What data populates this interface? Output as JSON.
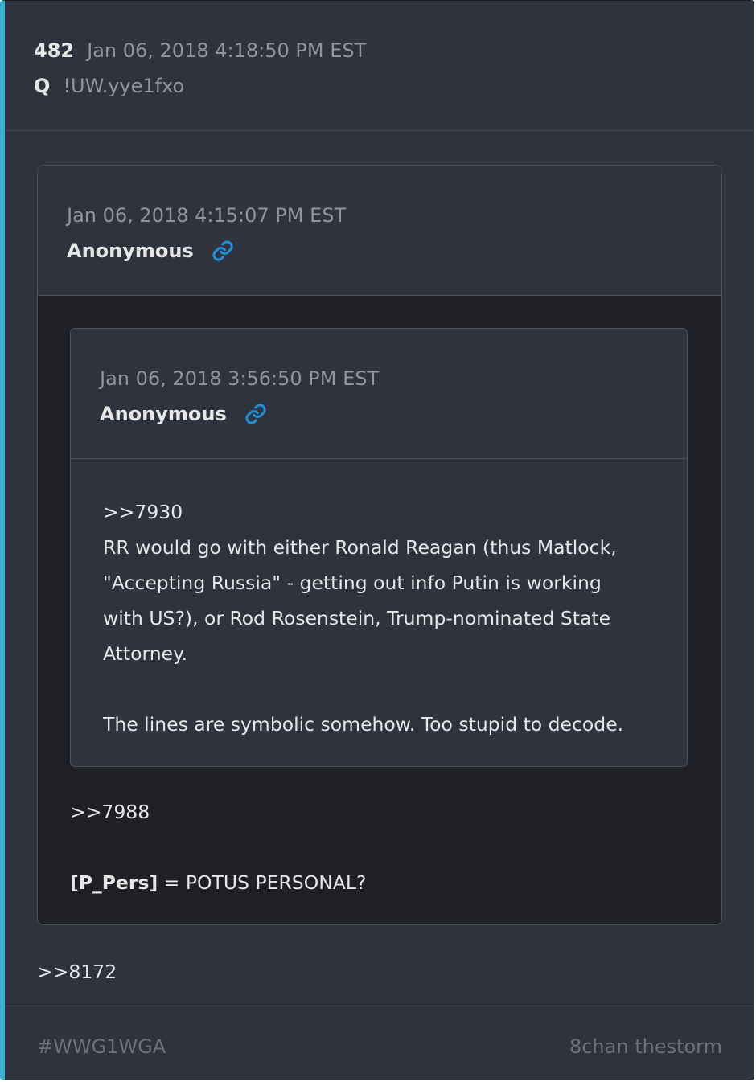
{
  "post": {
    "number": "482",
    "timestamp": "Jan 06, 2018 4:18:50 PM EST",
    "author": "Q",
    "tripcode": "!UW.yye1fxo",
    "reference": ">>8172"
  },
  "quoted_post": {
    "timestamp": "Jan 06, 2018 4:15:07 PM EST",
    "author": "Anonymous",
    "link_icon": "link-icon",
    "text_ref": ">>7988",
    "text_bold": "[P_Pers]",
    "text_rest": " = POTUS PERSONAL?"
  },
  "nested_post": {
    "timestamp": "Jan 06, 2018 3:56:50 PM EST",
    "author": "Anonymous",
    "link_icon": "link-icon",
    "text_ref": ">>7930",
    "text_para1_line1": "RR would go with either Ronald Reagan (thus Matlock,",
    "text_para1_line2": "\"Accepting Russia\" - getting out info Putin is working",
    "text_para1_line3": "with US?), or Rod Rosenstein, Trump-nominated State",
    "text_para1_line4": "Attorney.",
    "text_para2": "The lines are symbolic somehow. Too stupid to decode."
  },
  "footer": {
    "hashtag": "#WWG1WGA",
    "source": "8chan thestorm"
  },
  "colors": {
    "accent": "#2fb3cf",
    "link": "#1f8fd6",
    "card_bg": "#2e333d",
    "quote_bg": "#1e2026"
  }
}
